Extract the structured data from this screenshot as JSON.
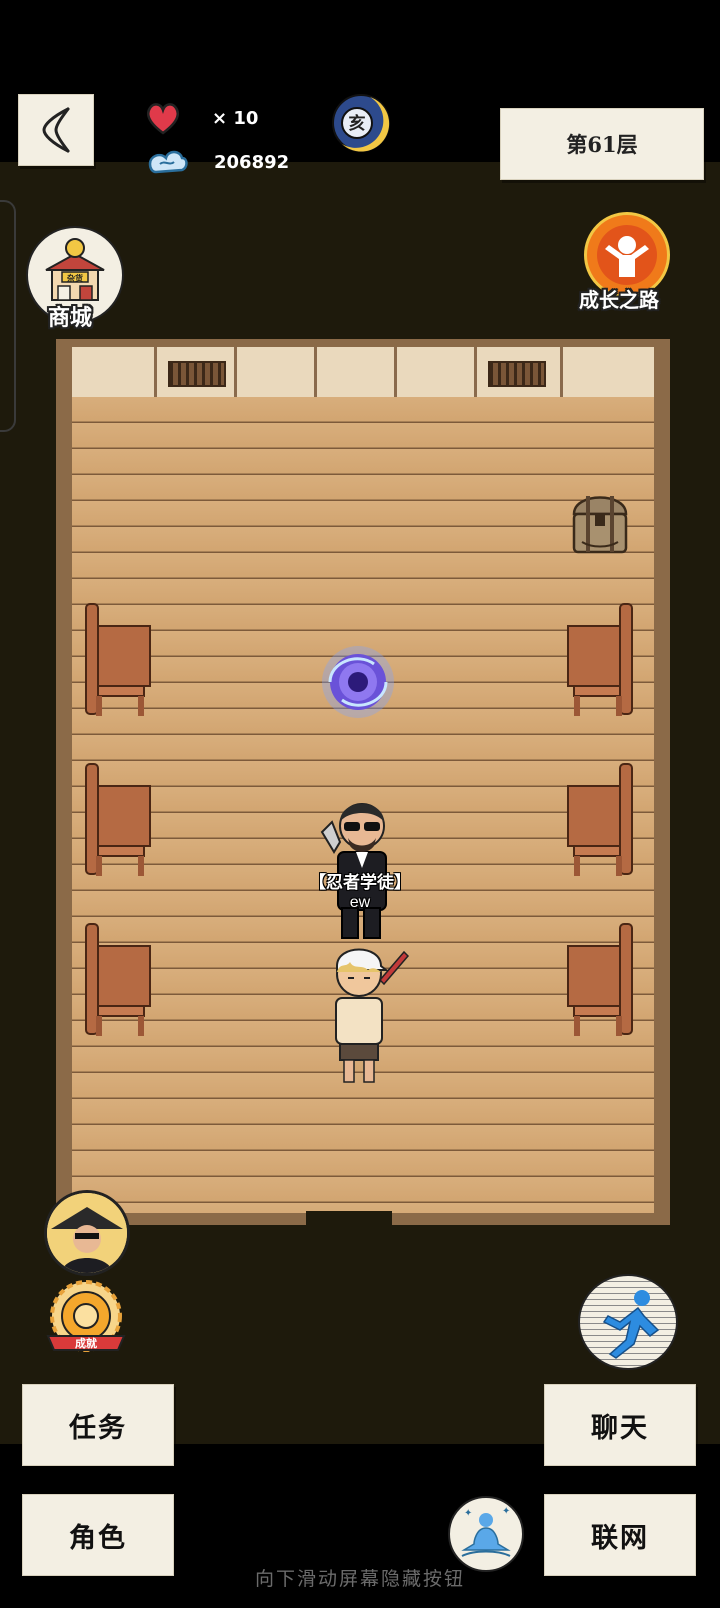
{
  "hud": {
    "hearts_label": "× 10",
    "currency_value": "206892",
    "moon_glyph": "亥",
    "level_label": "第61层"
  },
  "shortcuts": {
    "shop_label": "商城",
    "shop_sign_top": "杂货",
    "growth_label": "成长之路",
    "achievement_ribbon": "成就"
  },
  "npc": {
    "title": "【忍者学徒】",
    "name": "ew"
  },
  "buttons": {
    "task": "任务",
    "role": "角色",
    "chat": "聊天",
    "network": "联网"
  },
  "footer_hint": "向下滑动屏幕隐藏按钮",
  "colors": {
    "heart": "#e03a4a",
    "floor": "#d6ab78",
    "wall": "#ead9bd",
    "paper": "#f3efe3",
    "growth_orange": "#f07a1a"
  },
  "icons": [
    "back-chevron-icon",
    "heart-icon",
    "cloud-currency-icon",
    "moon-emblem-icon",
    "shop-icon",
    "growth-path-icon",
    "treasure-chest-icon",
    "portal-icon",
    "ninja-avatar-icon",
    "achievement-badge-icon",
    "running-man-icon",
    "meditation-icon"
  ]
}
